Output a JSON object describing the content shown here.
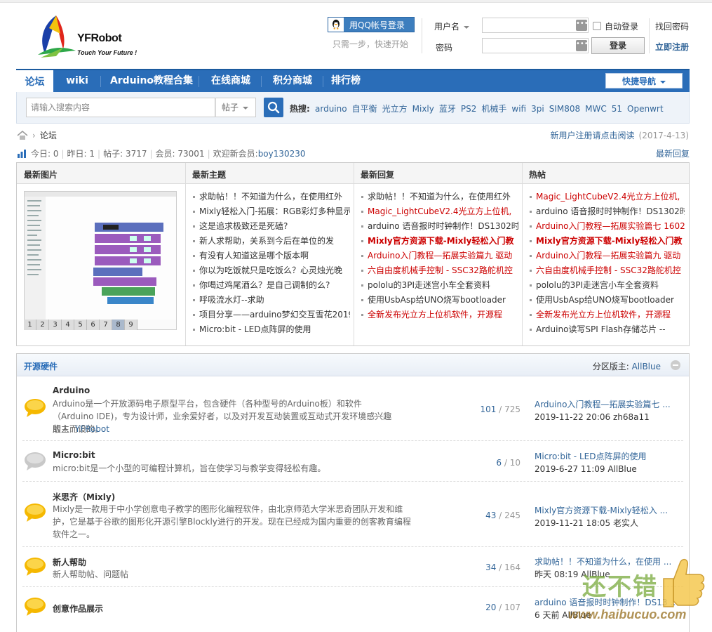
{
  "header": {
    "logo_text": "YFRobot",
    "logo_slogan": "Touch Your Future !",
    "qq_login": "用QQ帐号登录",
    "qq_tip": "只需一步，快速开始",
    "username_label": "用户名",
    "password_label": "密码",
    "auto_login": "自动登录",
    "find_password": "找回密码",
    "login_button": "登录",
    "register": "立即注册",
    "dots": "•••"
  },
  "nav": {
    "items": [
      {
        "label": "论坛"
      },
      {
        "label": "wiki"
      },
      {
        "label": "Arduino教程合集"
      },
      {
        "label": "在线商城"
      },
      {
        "label": "积分商城"
      },
      {
        "label": "排行榜"
      }
    ],
    "quick_nav": "快捷导航"
  },
  "search": {
    "placeholder": "请输入搜索内容",
    "type": "帖子",
    "hot_label": "热搜:",
    "hot": [
      "arduino",
      "自平衡",
      "光立方",
      "Mixly",
      "蓝牙",
      "PS2",
      "机械手",
      "wifi",
      "3pi",
      "SIM808",
      "MWC",
      "51",
      "Openwrt"
    ]
  },
  "breadcrumb": {
    "current": "论坛",
    "separator": "›"
  },
  "notice": {
    "text": "新用户注册请点击阅读",
    "date": "(2017-4-13)"
  },
  "stats": {
    "today": "今日: 0",
    "yesterday": "昨日: 1",
    "posts": "帖子: 3717",
    "members": "会员: 73001",
    "new_member_label": "欢迎新会员: ",
    "new_member": "boy130230",
    "sep": "|",
    "latest_reply": "最新回复"
  },
  "portal": {
    "col_titles": [
      "最新图片",
      "最新主题",
      "最新回复",
      "热帖"
    ],
    "pager": [
      "1",
      "2",
      "3",
      "4",
      "5",
      "6",
      "7",
      "8",
      "9"
    ],
    "pager_current": "8",
    "latest_topics": [
      {
        "text": "求助帖！！不知道为什么，在使用红外",
        "style": ""
      },
      {
        "text": "Mixly轻松入门-拓展：RGB彩灯多种显示",
        "style": ""
      },
      {
        "text": "这是追求极致还是死磕?",
        "style": ""
      },
      {
        "text": "新人求帮助，关系到今后在单位的发",
        "style": ""
      },
      {
        "text": "有没有人知道这是哪个版本啊",
        "style": ""
      },
      {
        "text": "你以为吃饭就只是吃饭么？心灵烛光晚",
        "style": ""
      },
      {
        "text": "你喝过鸡尾酒么？是自己调制的么?",
        "style": ""
      },
      {
        "text": "呼吸流水灯--求助",
        "style": ""
      },
      {
        "text": "项目分享——arduino梦幻交互雪花2019",
        "style": ""
      },
      {
        "text": "Micro:bit - LED点阵屏的使用",
        "style": ""
      }
    ],
    "latest_replies": [
      {
        "text": "求助帖！！不知道为什么，在使用红外",
        "style": ""
      },
      {
        "text": "Magic_LightCubeV2.4光立方上位机,",
        "style": "red"
      },
      {
        "text": "arduino 语音报时时钟制作！DS1302时",
        "style": ""
      },
      {
        "text": "Mixly官方资源下载-Mixly轻松入门教",
        "style": "redb"
      },
      {
        "text": "Arduino入门教程—拓展实验篇九 驱动",
        "style": "red"
      },
      {
        "text": "六自由度机械手控制 - SSC32路舵机控",
        "style": "red"
      },
      {
        "text": "pololu的3PI走迷宫小车全套资料",
        "style": ""
      },
      {
        "text": "使用UsbAsp给UNO烧写bootloader",
        "style": ""
      },
      {
        "text": "全新发布光立方上位机软件，开源程",
        "style": "red"
      }
    ],
    "hot_posts": [
      {
        "text": "Magic_LightCubeV2.4光立方上位机,",
        "style": "red"
      },
      {
        "text": "arduino 语音报时时钟制作！DS1302时",
        "style": ""
      },
      {
        "text": "Arduino入门教程—拓展实验篇七 1602",
        "style": "red"
      },
      {
        "text": "Mixly官方资源下载-Mixly轻松入门教",
        "style": "redb"
      },
      {
        "text": "Arduino入门教程—拓展实验篇九 驱动",
        "style": "red"
      },
      {
        "text": "六自由度机械手控制 - SSC32路舵机控",
        "style": "red"
      },
      {
        "text": "pololu的3PI走迷宫小车全套资料",
        "style": ""
      },
      {
        "text": "使用UsbAsp给UNO烧写bootloader",
        "style": ""
      },
      {
        "text": "全新发布光立方上位机软件，开源程",
        "style": "red"
      },
      {
        "text": "Arduino读写SPI Flash存储芯片 --",
        "style": ""
      }
    ],
    "latest_topic_extra": "Arduino入门教程—拓展实验篇七 1602"
  },
  "forum": {
    "title": "开源硬件",
    "moderator_label": "分区版主: ",
    "moderator": "AllBlue",
    "boards": [
      {
        "name": "Arduino",
        "desc": "Arduino是一个开放源码电子原型平台，包含硬件（各种型号的Arduino板）和软件（Arduino IDE)，专为设计师，业余爱好者，以及对开发互动装置或互动式开发环境感兴趣的人而设的。",
        "mod_label": "版主: ",
        "mod": "YFRobot",
        "threads": "101",
        "posts": "725",
        "last_title": "Arduino入门教程—拓展实验篇七 ...",
        "last_meta": "2019-11-22 20:06 zh68a11",
        "active": true
      },
      {
        "name": "Micro:bit",
        "desc": "micro:bit是一个小型的可编程计算机，旨在使学习与教学变得轻松有趣。",
        "threads": "6",
        "posts": "10",
        "last_title": "Micro:bit - LED点阵屏的使用",
        "last_meta": "2019-6-27 11:09 AllBlue",
        "active": false
      },
      {
        "name": "米思齐（Mixly)",
        "desc": "Mixly是一款用于中小学创意电子教学的图形化编程软件，由北京师范大学米思奇团队开发和维护，它是基于谷歌的图形化开源引擎Blockly进行的开发。现在已经成为国内重要的创客教育编程软件之一。",
        "threads": "43",
        "posts": "245",
        "last_title": "Mixly官方资源下载-Mixly轻松入 ...",
        "last_meta": "2019-11-21 18:05 老实人",
        "active": true
      },
      {
        "name": "新人帮助",
        "desc": "新人帮助帖、问题帖",
        "threads": "34",
        "posts": "164",
        "last_title": "求助帖！！不知道为什么，在使用 ...",
        "last_meta": "昨天 08:19 AllBlue",
        "active": true
      },
      {
        "name": "创意作品展示",
        "desc": "",
        "threads": "20",
        "posts": "107",
        "last_title": "arduino 语音报时时钟制作！DS13 ...",
        "last_meta": "6 天前 AllBlue",
        "active": true
      }
    ],
    "count_sep": " / "
  },
  "watermark": {
    "text": "还不错",
    "url": "www.haibucuo.com"
  },
  "colors": {
    "nav": "#2a6db8",
    "link": "#336699",
    "hot": "#cc0000",
    "bubble_active": "#f5b800",
    "bubble_inactive": "#c8c8c8"
  }
}
